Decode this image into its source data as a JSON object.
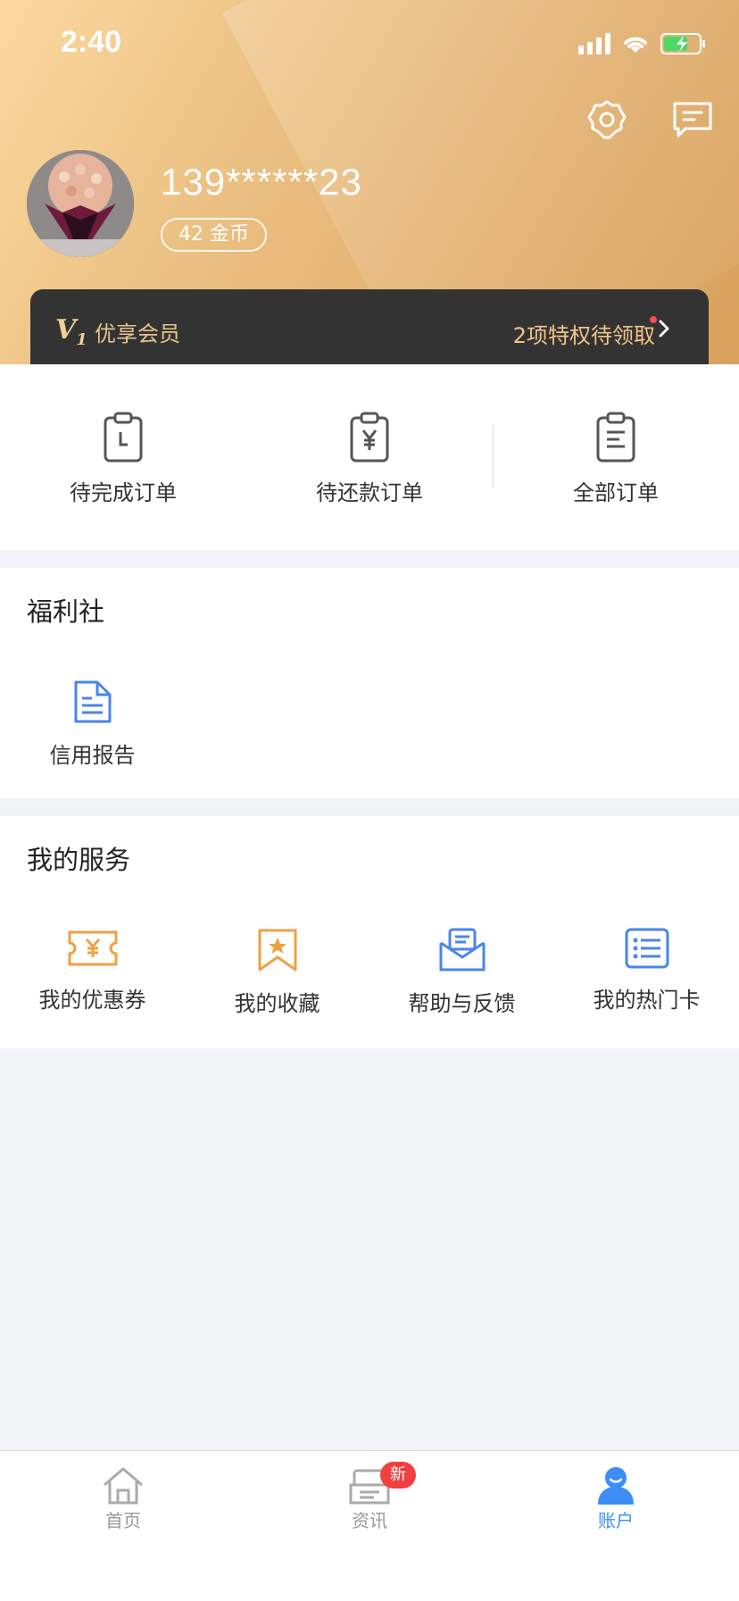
{
  "status_bar": {
    "time": "2:40"
  },
  "header": {
    "phone": "139******23",
    "coins": "42 金币"
  },
  "member": {
    "logo": "V",
    "logo_sub": "1",
    "label": "优享会员",
    "perks": "2项特权待领取"
  },
  "orders": [
    {
      "label": "待完成订单",
      "icon": "clipboard-clock-icon"
    },
    {
      "label": "待还款订单",
      "icon": "clipboard-yen-icon"
    },
    {
      "label": "全部订单",
      "icon": "clipboard-list-icon"
    }
  ],
  "welfare": {
    "title": "福利社",
    "items": [
      {
        "label": "信用报告",
        "icon": "document-icon"
      }
    ]
  },
  "services": {
    "title": "我的服务",
    "items": [
      {
        "label": "我的优惠券",
        "icon": "coupon-icon"
      },
      {
        "label": "我的收藏",
        "icon": "bookmark-star-icon"
      },
      {
        "label": "帮助与反馈",
        "icon": "help-envelope-icon"
      },
      {
        "label": "我的热门卡",
        "icon": "card-list-icon"
      }
    ]
  },
  "tabbar": {
    "items": [
      {
        "label": "首页",
        "icon": "home-icon"
      },
      {
        "label": "资讯",
        "icon": "news-icon",
        "badge": "新"
      },
      {
        "label": "账户",
        "icon": "account-icon"
      }
    ]
  },
  "colors": {
    "accent": "#3a8ef6",
    "gold": "#e8c48c",
    "orange": "#f0a043",
    "badge": "#f23f3f"
  }
}
